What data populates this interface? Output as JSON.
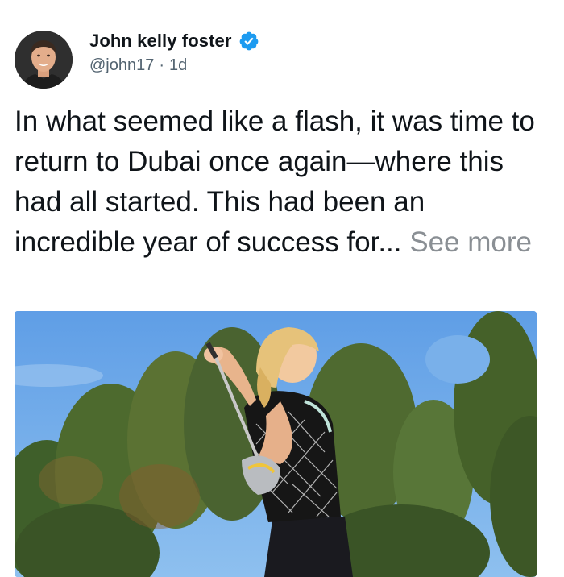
{
  "author": {
    "display_name": "John kelly foster",
    "handle": "@john17",
    "separator": "·",
    "timestamp": "1d",
    "verified": true,
    "verified_color": "#1d9bf0"
  },
  "tweet": {
    "text": "In what seemed like a flash, it was time to return to Dubai once again—where this had all started. This had been an incredible year of success for...",
    "see_more_label": "See more"
  },
  "colors": {
    "text": "#0f1419",
    "secondary": "#536471",
    "see_more": "#8a8f94",
    "sky": "#6fa7e4"
  },
  "icons": {
    "verified": "verified-badge-icon"
  }
}
